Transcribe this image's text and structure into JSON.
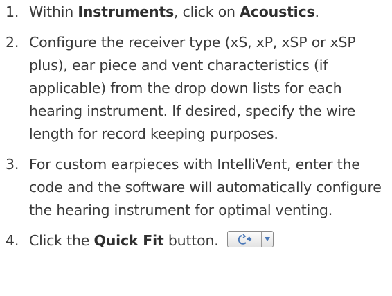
{
  "steps": [
    {
      "number": "1.",
      "parts": [
        "Within ",
        "Instruments",
        ", click on ",
        "Acoustics",
        "."
      ]
    },
    {
      "number": "2.",
      "text": "Configure the receiver type (xS, xP, xSP or xSP plus), ear piece and vent characteristics (if applicable) from the drop down lists for each hearing instrument. If desired, specify the wire length for record keeping purposes."
    },
    {
      "number": "3.",
      "text": "For custom earpieces with IntelliVent, enter the code and the software will automatically configure the hearing instrument for optimal venting."
    },
    {
      "number": "4.",
      "parts": [
        "Click the ",
        "Quick Fit",
        " button."
      ]
    }
  ],
  "quick_fit_button": {
    "main_icon": "quick-fit-icon",
    "arrow_icon": "dropdown-arrow-icon"
  },
  "colors": {
    "text": "#3a3a3a",
    "icon_blue": "#4a78b8"
  }
}
